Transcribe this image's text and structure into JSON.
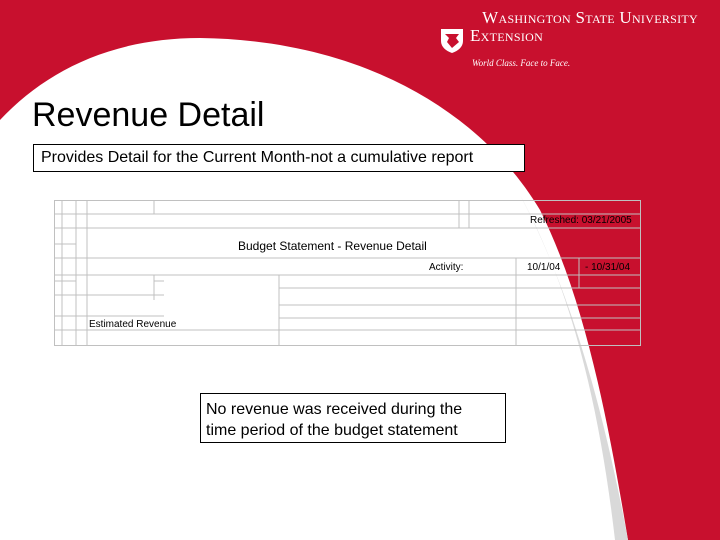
{
  "branding": {
    "line1": "Washington State University",
    "line2": "Extension",
    "tagline": "World Class. Face to Face.",
    "accent_color": "#c8102e",
    "logo_icon": "wsu-cougar-logo-icon"
  },
  "slide": {
    "title": "Revenue Detail",
    "subtitle": "Provides Detail for the Current Month-not a cumulative report"
  },
  "report": {
    "refreshed": "Refreshed: 03/21/2005",
    "title": "Budget Statement - Revenue Detail",
    "activity_label": "Activity:",
    "date_from": "10/1/04",
    "date_to": "- 10/31/04",
    "estimated_revenue_label": "Estimated Revenue"
  },
  "note": {
    "line1": "No revenue was received during the",
    "line2": "time period of the budget statement"
  }
}
